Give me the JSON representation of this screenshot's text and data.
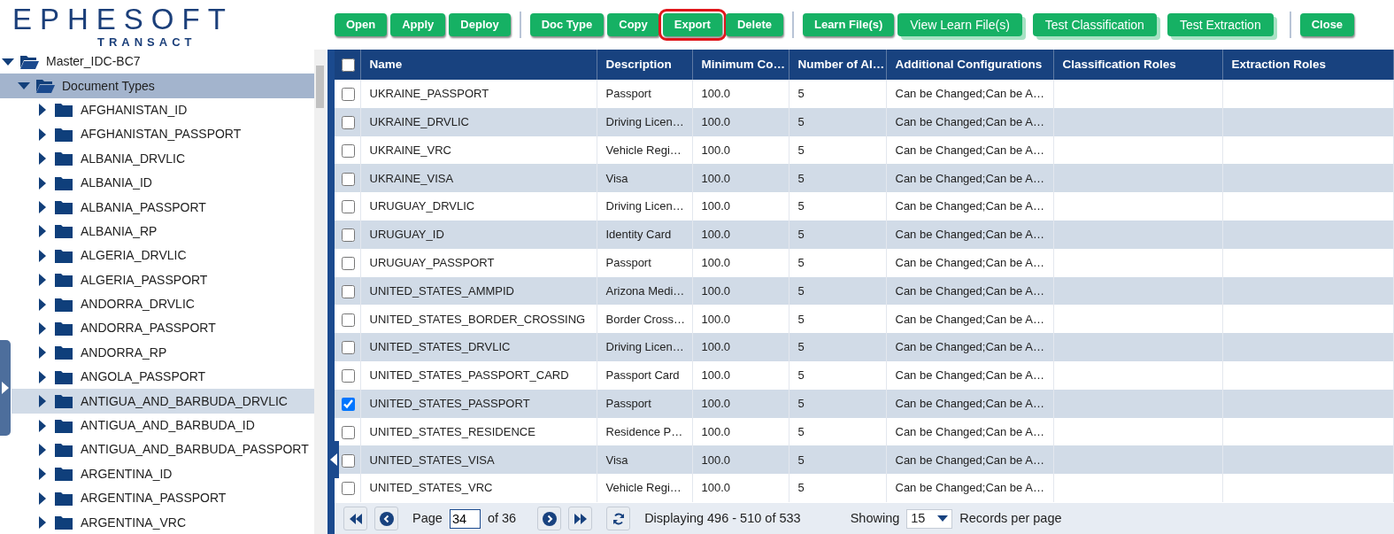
{
  "logo": {
    "name": "EPHESOFT",
    "subtitle": "TRANSACT"
  },
  "toolbar": [
    {
      "buttons": [
        {
          "label": "Open",
          "kind": "small",
          "highlighted": false
        },
        {
          "label": "Apply",
          "kind": "small",
          "highlighted": false
        },
        {
          "label": "Deploy",
          "kind": "small",
          "highlighted": false
        }
      ]
    },
    {
      "buttons": [
        {
          "label": "Doc Type",
          "kind": "small",
          "highlighted": false
        },
        {
          "label": "Copy",
          "kind": "small",
          "highlighted": false
        },
        {
          "label": "Export",
          "kind": "small",
          "highlighted": true
        },
        {
          "label": "Delete",
          "kind": "small",
          "highlighted": false
        }
      ]
    },
    {
      "buttons": [
        {
          "label": "Learn File(s)",
          "kind": "small",
          "highlighted": false
        },
        {
          "label": "View Learn File(s)",
          "kind": "large",
          "highlighted": false
        },
        {
          "label": "Test Classification",
          "kind": "large",
          "highlighted": false
        },
        {
          "label": "Test Extraction",
          "kind": "large",
          "highlighted": false
        }
      ]
    },
    {
      "buttons": [
        {
          "label": "Close",
          "kind": "small",
          "highlighted": false
        }
      ]
    }
  ],
  "tree": [
    {
      "label": "Master_IDC-BC7",
      "expanded": true,
      "selected": false,
      "children": [
        {
          "label": "Document Types",
          "expanded": true,
          "selected": true,
          "children": [
            {
              "label": "AFGHANISTAN_ID",
              "expanded": false,
              "selected": false
            },
            {
              "label": "AFGHANISTAN_PASSPORT",
              "expanded": false,
              "selected": false
            },
            {
              "label": "ALBANIA_DRVLIC",
              "expanded": false,
              "selected": false
            },
            {
              "label": "ALBANIA_ID",
              "expanded": false,
              "selected": false
            },
            {
              "label": "ALBANIA_PASSPORT",
              "expanded": false,
              "selected": false
            },
            {
              "label": "ALBANIA_RP",
              "expanded": false,
              "selected": false
            },
            {
              "label": "ALGERIA_DRVLIC",
              "expanded": false,
              "selected": false
            },
            {
              "label": "ALGERIA_PASSPORT",
              "expanded": false,
              "selected": false
            },
            {
              "label": "ANDORRA_DRVLIC",
              "expanded": false,
              "selected": false
            },
            {
              "label": "ANDORRA_PASSPORT",
              "expanded": false,
              "selected": false
            },
            {
              "label": "ANDORRA_RP",
              "expanded": false,
              "selected": false
            },
            {
              "label": "ANGOLA_PASSPORT",
              "expanded": false,
              "selected": false
            },
            {
              "label": "ANTIGUA_AND_BARBUDA_DRVLIC",
              "expanded": false,
              "selected": true
            },
            {
              "label": "ANTIGUA_AND_BARBUDA_ID",
              "expanded": false,
              "selected": false
            },
            {
              "label": "ANTIGUA_AND_BARBUDA_PASSPORT",
              "expanded": false,
              "selected": false
            },
            {
              "label": "ARGENTINA_ID",
              "expanded": false,
              "selected": false
            },
            {
              "label": "ARGENTINA_PASSPORT",
              "expanded": false,
              "selected": false
            },
            {
              "label": "ARGENTINA_VRC",
              "expanded": false,
              "selected": false
            }
          ]
        }
      ]
    }
  ],
  "table": {
    "select_all_checked": false,
    "columns": [
      "Name",
      "Description",
      "Minimum Co…",
      "Number of Al…",
      "Additional Configurations",
      "Classification Roles",
      "Extraction Roles"
    ],
    "rows": [
      {
        "checked": false,
        "cells": [
          "UKRAINE_PASSPORT",
          "Passport",
          "100.0",
          "5",
          "Can be Changed;Can be A…"
        ]
      },
      {
        "checked": false,
        "cells": [
          "UKRAINE_DRVLIC",
          "Driving Licen…",
          "100.0",
          "5",
          "Can be Changed;Can be A…"
        ]
      },
      {
        "checked": false,
        "cells": [
          "UKRAINE_VRC",
          "Vehicle Regi…",
          "100.0",
          "5",
          "Can be Changed;Can be A…"
        ]
      },
      {
        "checked": false,
        "cells": [
          "UKRAINE_VISA",
          "Visa",
          "100.0",
          "5",
          "Can be Changed;Can be A…"
        ]
      },
      {
        "checked": false,
        "cells": [
          "URUGUAY_DRVLIC",
          "Driving Licen…",
          "100.0",
          "5",
          "Can be Changed;Can be A…"
        ]
      },
      {
        "checked": false,
        "cells": [
          "URUGUAY_ID",
          "Identity Card",
          "100.0",
          "5",
          "Can be Changed;Can be A…"
        ]
      },
      {
        "checked": false,
        "cells": [
          "URUGUAY_PASSPORT",
          "Passport",
          "100.0",
          "5",
          "Can be Changed;Can be A…"
        ]
      },
      {
        "checked": false,
        "cells": [
          "UNITED_STATES_AMMPID",
          "Arizona Medi…",
          "100.0",
          "5",
          "Can be Changed;Can be A…"
        ]
      },
      {
        "checked": false,
        "cells": [
          "UNITED_STATES_BORDER_CROSSING",
          "Border Cross…",
          "100.0",
          "5",
          "Can be Changed;Can be A…"
        ]
      },
      {
        "checked": false,
        "cells": [
          "UNITED_STATES_DRVLIC",
          "Driving Licen…",
          "100.0",
          "5",
          "Can be Changed;Can be A…"
        ]
      },
      {
        "checked": false,
        "cells": [
          "UNITED_STATES_PASSPORT_CARD",
          "Passport Card",
          "100.0",
          "5",
          "Can be Changed;Can be A…"
        ]
      },
      {
        "checked": true,
        "cells": [
          "UNITED_STATES_PASSPORT",
          "Passport",
          "100.0",
          "5",
          "Can be Changed;Can be A…"
        ]
      },
      {
        "checked": false,
        "cells": [
          "UNITED_STATES_RESIDENCE",
          "Residence P…",
          "100.0",
          "5",
          "Can be Changed;Can be A…"
        ]
      },
      {
        "checked": false,
        "cells": [
          "UNITED_STATES_VISA",
          "Visa",
          "100.0",
          "5",
          "Can be Changed;Can be A…"
        ]
      },
      {
        "checked": false,
        "cells": [
          "UNITED_STATES_VRC",
          "Vehicle Regi…",
          "100.0",
          "5",
          "Can be Changed;Can be A…"
        ]
      }
    ]
  },
  "pager": {
    "page_label": "Page",
    "page": "34",
    "of": "of 36",
    "displaying": "Displaying 496 - 510 of 533",
    "showing": "Showing",
    "per_page": "15",
    "records": "Records per page"
  }
}
